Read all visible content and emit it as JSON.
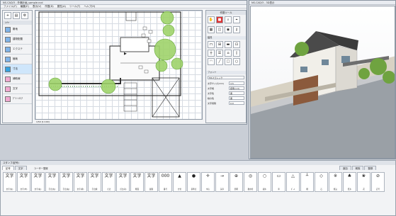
{
  "left_window": {
    "title": "NS-CAD/3 - 外構計画_sample.ncd"
  },
  "menu": [
    "ファイル(F)",
    "編集(E)",
    "表示(V)",
    "作図(D)",
    "属性(A)",
    "ツール(T)",
    "ヘルプ(H)"
  ],
  "layer_panel": {
    "tabs": [
      "レイヤー"
    ],
    "header": "ﾚｲﾔｰ",
    "items": [
      {
        "label": "敷地",
        "color": "#7fb3e8"
      },
      {
        "label": "建物配置",
        "color": "#7fb3e8"
      },
      {
        "label": "エクステ",
        "color": "#7fb3e8"
      },
      {
        "label": "植栽",
        "color": "#7fb3e8"
      },
      {
        "label": "寸法",
        "color": "#36a2e0",
        "selected": true
      },
      {
        "label": "補助線",
        "color": "#f0a8d0"
      },
      {
        "label": "文字",
        "color": "#f0a8d0"
      },
      {
        "label": "ｸﾞﾘｰﾝｴﾘｱ",
        "color": "#f0a8d0"
      }
    ]
  },
  "draw_status": "1/50 [1:100]",
  "props_panel": {
    "title": "作図ツール",
    "section1": "建具",
    "section2": "フォント",
    "font_name": "MS Pゴシック",
    "rows": [
      {
        "label": "文字サイズ(mm)",
        "value": "3.5"
      },
      {
        "label": "文字幅",
        "value": "標準(1.0)"
      },
      {
        "label": "文字色",
        "value": "黒"
      },
      {
        "label": "線の色",
        "value": "黒"
      },
      {
        "label": "文字間隔",
        "value": "0.0"
      }
    ]
  },
  "view3d": {
    "title": "NS-CAD/3 - 3D表示"
  },
  "stamp_panel": {
    "title": "スタンプ(記号)",
    "tabs": [
      "記号",
      "文字"
    ],
    "group_label": "ユーザー登録",
    "right_buttons": [
      "追加",
      "削除",
      "登録"
    ],
    "cells": [
      {
        "icon": "文字",
        "label": "文字(左)"
      },
      {
        "icon": "文字",
        "label": "文字(中)"
      },
      {
        "icon": "文字",
        "label": "文字(右)"
      },
      {
        "icon": "文字",
        "label": "引出(左)"
      },
      {
        "icon": "文字",
        "label": "引出(右)"
      },
      {
        "icon": "文字",
        "label": "文字(枠)"
      },
      {
        "icon": "文字",
        "label": "引出線"
      },
      {
        "icon": "文字",
        "label": "寸法"
      },
      {
        "icon": "文字",
        "label": "寸法(円)"
      },
      {
        "icon": "文字",
        "label": "断面"
      },
      {
        "icon": "文字",
        "label": "展開"
      },
      {
        "icon": "000",
        "label": "番号"
      },
      {
        "icon": "▲",
        "label": "方位"
      },
      {
        "icon": "●",
        "label": "基準点"
      },
      {
        "icon": "✛",
        "label": "中心"
      },
      {
        "icon": "→",
        "label": "矢印"
      },
      {
        "icon": "⊕",
        "label": "照明"
      },
      {
        "icon": "◎",
        "label": "散水栓"
      },
      {
        "icon": "○",
        "label": "樹木"
      },
      {
        "icon": "▭",
        "label": "車"
      },
      {
        "icon": "△",
        "label": "ﾎﾟｰﾙ"
      },
      {
        "icon": "┴",
        "label": "柵"
      },
      {
        "icon": "◇",
        "label": "石"
      },
      {
        "icon": "※",
        "label": "植込"
      },
      {
        "icon": "♣",
        "label": "低木"
      },
      {
        "icon": "❀",
        "label": "花"
      },
      {
        "icon": "⊘",
        "label": "記号"
      }
    ]
  },
  "statusbar": {
    "text": ""
  }
}
